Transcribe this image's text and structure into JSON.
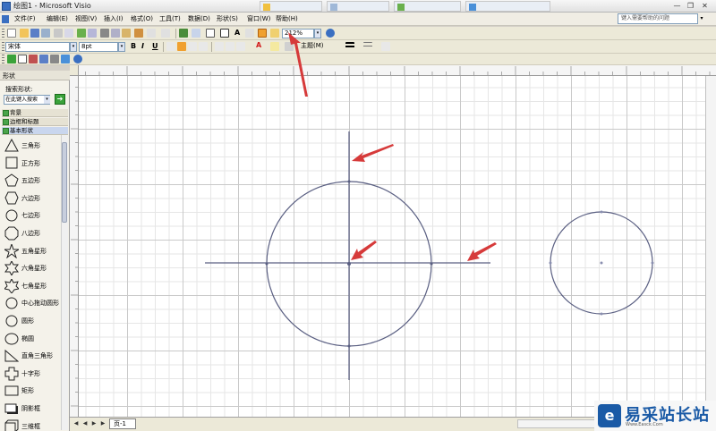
{
  "window": {
    "title": "绘图1 - Microsoft Visio",
    "background_tabs": [
      "",
      "",
      "",
      ""
    ],
    "controls": [
      "—",
      "❐",
      "✕"
    ]
  },
  "menubar": {
    "items": [
      "文件(F)",
      "编辑(E)",
      "视图(V)",
      "插入(I)",
      "格式(O)",
      "工具(T)",
      "数据(D)",
      "形状(S)",
      "窗口(W)",
      "帮助(H)"
    ],
    "help_placeholder": "键入需要帮助的问题"
  },
  "toolbar": {
    "zoom": "212%",
    "font_name": "宋体",
    "font_size": "8pt",
    "bold_label": "B",
    "italic_label": "I",
    "underline_label": "U",
    "theme_label": "主题(M)",
    "colors": {
      "accent": "#f0a030",
      "font_red": "#d21a1a"
    }
  },
  "shapes_panel": {
    "title": "形状",
    "search_label": "搜索形状:",
    "search_value": "在此键入搜索",
    "stencils": [
      "背景",
      "边框和标题",
      "基本形状"
    ],
    "items": [
      {
        "label": "三角形",
        "icon": "triangle-icon"
      },
      {
        "label": "正方形",
        "icon": "square-icon"
      },
      {
        "label": "五边形",
        "icon": "pentagon-icon"
      },
      {
        "label": "六边形",
        "icon": "hexagon-icon"
      },
      {
        "label": "七边形",
        "icon": "heptagon-icon"
      },
      {
        "label": "八边形",
        "icon": "octagon-icon"
      },
      {
        "label": "五角星形",
        "icon": "star5-icon"
      },
      {
        "label": "六角星形",
        "icon": "star6-icon"
      },
      {
        "label": "七角星形",
        "icon": "star7-icon"
      },
      {
        "label": "中心拖动圆形",
        "icon": "center-circle-icon"
      },
      {
        "label": "圆形",
        "icon": "circle-icon"
      },
      {
        "label": "椭圆",
        "icon": "ellipse-icon"
      },
      {
        "label": "直角三角形",
        "icon": "right-triangle-icon"
      },
      {
        "label": "十字形",
        "icon": "cross-icon"
      },
      {
        "label": "矩形",
        "icon": "rectangle-icon"
      },
      {
        "label": "阴影框",
        "icon": "shadow-box-icon"
      },
      {
        "label": "三维框",
        "icon": "3d-box-icon"
      }
    ]
  },
  "statusbar": {
    "page_tab": "页-1"
  },
  "watermark": {
    "brand": "易采站长站",
    "url": "Www.Easck.Com"
  },
  "colors": {
    "shape_stroke": "#5a5f82",
    "arrow": "#d63a3a",
    "grid_major": "#c9c9c9",
    "grid_minor": "#e6e6e6"
  }
}
